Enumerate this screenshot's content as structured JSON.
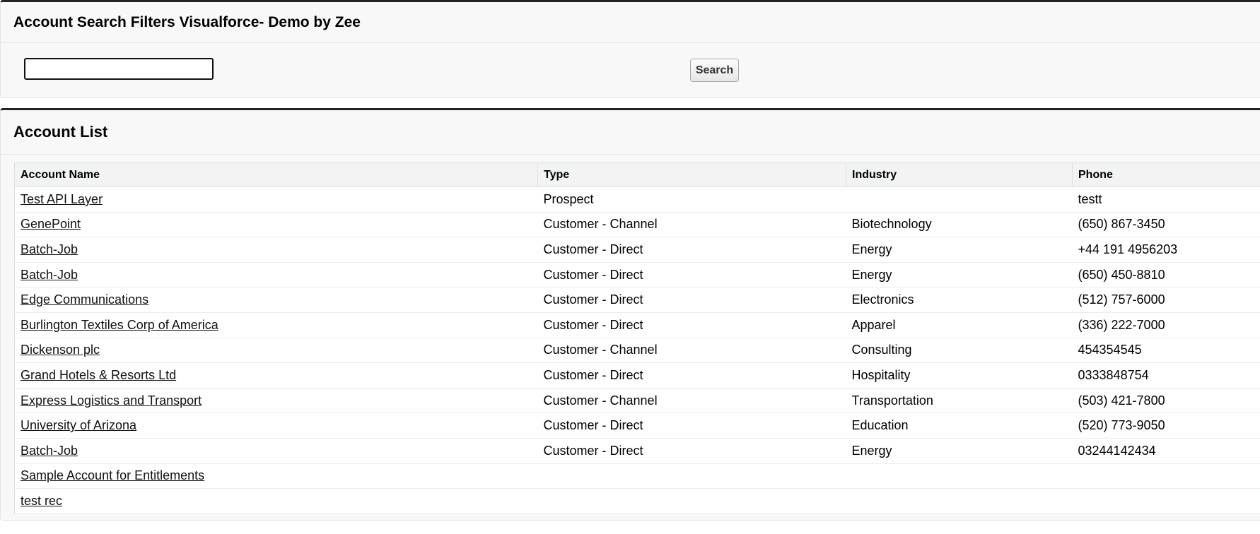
{
  "search_panel": {
    "title": "Account Search Filters Visualforce- Demo by Zee",
    "input_value": "",
    "button_label": "Search"
  },
  "list_panel": {
    "title": "Account List",
    "columns": [
      "Account Name",
      "Type",
      "Industry",
      "Phone"
    ],
    "rows": [
      {
        "name": "Test API Layer",
        "type": "Prospect",
        "industry": "",
        "phone": "testt"
      },
      {
        "name": "GenePoint",
        "type": "Customer - Channel",
        "industry": "Biotechnology",
        "phone": "(650) 867-3450"
      },
      {
        "name": "Batch-Job",
        "type": "Customer - Direct",
        "industry": "Energy",
        "phone": "+44 191 4956203"
      },
      {
        "name": "Batch-Job",
        "type": "Customer - Direct",
        "industry": "Energy",
        "phone": "(650) 450-8810"
      },
      {
        "name": "Edge Communications",
        "type": "Customer - Direct",
        "industry": "Electronics",
        "phone": "(512) 757-6000"
      },
      {
        "name": "Burlington Textiles Corp of America",
        "type": "Customer - Direct",
        "industry": "Apparel",
        "phone": "(336) 222-7000"
      },
      {
        "name": "Dickenson plc",
        "type": "Customer - Channel",
        "industry": "Consulting",
        "phone": "454354545"
      },
      {
        "name": "Grand Hotels & Resorts Ltd",
        "type": "Customer - Direct",
        "industry": "Hospitality",
        "phone": "0333848754"
      },
      {
        "name": "Express Logistics and Transport",
        "type": "Customer - Channel",
        "industry": "Transportation",
        "phone": "(503) 421-7800"
      },
      {
        "name": "University of Arizona",
        "type": "Customer - Direct",
        "industry": "Education",
        "phone": "(520) 773-9050"
      },
      {
        "name": "Batch-Job",
        "type": "Customer - Direct",
        "industry": "Energy",
        "phone": "03244142434"
      },
      {
        "name": "Sample Account for Entitlements",
        "type": "",
        "industry": "",
        "phone": ""
      },
      {
        "name": "test rec",
        "type": "",
        "industry": "",
        "phone": ""
      }
    ]
  }
}
